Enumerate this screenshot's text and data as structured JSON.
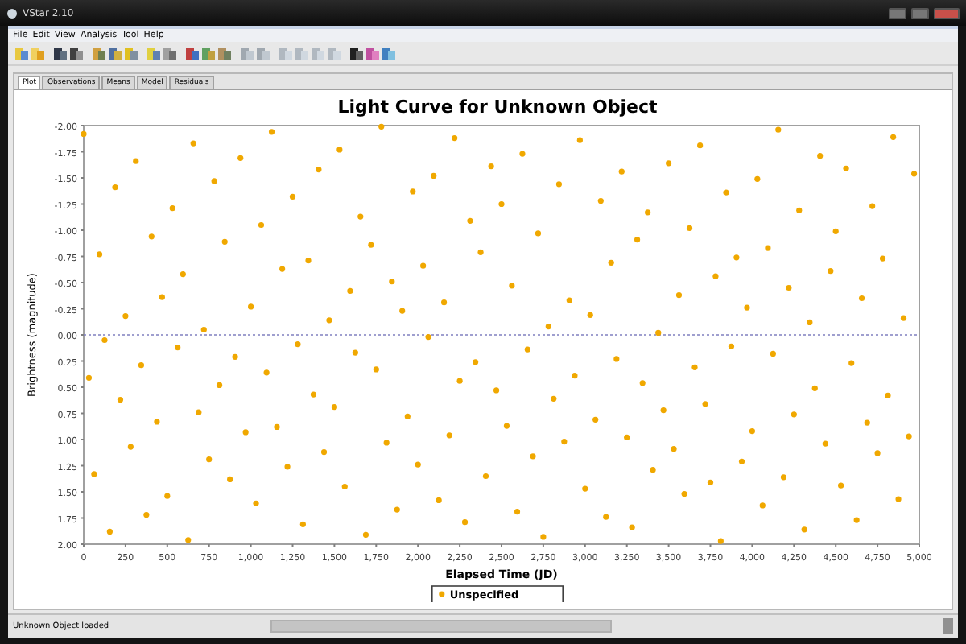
{
  "window": {
    "title": "VStar 2.10"
  },
  "menu": [
    "File",
    "Edit",
    "View",
    "Analysis",
    "Tool",
    "Help"
  ],
  "tabs": [
    {
      "label": "Plot",
      "selected": true
    },
    {
      "label": "Observations",
      "selected": false
    },
    {
      "label": "Means",
      "selected": false
    },
    {
      "label": "Model",
      "selected": false
    },
    {
      "label": "Residuals",
      "selected": false
    }
  ],
  "plot": {
    "chart_data": {
      "type": "scatter",
      "title": "Light Curve for Unknown Object",
      "xlabel": "Elapsed Time (JD)",
      "ylabel": "Brightness (magnitude)",
      "xlim": [
        0,
        5000
      ],
      "ylim": [
        2,
        -2
      ],
      "ref_lines": [
        {
          "axis": "y",
          "value": 0
        }
      ],
      "xticks": [
        {
          "value": 0,
          "label": "0"
        },
        {
          "value": 250,
          "label": "250"
        },
        {
          "value": 500,
          "label": "500"
        },
        {
          "value": 750,
          "label": "750"
        },
        {
          "value": 1000,
          "label": "1,000"
        },
        {
          "value": 1250,
          "label": "1,250"
        },
        {
          "value": 1500,
          "label": "1,500"
        },
        {
          "value": 1750,
          "label": "1,750"
        },
        {
          "value": 2000,
          "label": "2,000"
        },
        {
          "value": 2250,
          "label": "2,250"
        },
        {
          "value": 2500,
          "label": "2,500"
        },
        {
          "value": 2750,
          "label": "2,750"
        },
        {
          "value": 3000,
          "label": "3,000"
        },
        {
          "value": 3250,
          "label": "3,250"
        },
        {
          "value": 3500,
          "label": "3,500"
        },
        {
          "value": 3750,
          "label": "3,750"
        },
        {
          "value": 4000,
          "label": "4,000"
        },
        {
          "value": 4250,
          "label": "4,250"
        },
        {
          "value": 4500,
          "label": "4,500"
        },
        {
          "value": 4750,
          "label": "4,750"
        },
        {
          "value": 5000,
          "label": "5,000"
        }
      ],
      "yticks": [
        {
          "value": -2,
          "label": "-2.00"
        },
        {
          "value": -1.75,
          "label": "-1.75"
        },
        {
          "value": -1.5,
          "label": "-1.50"
        },
        {
          "value": -1.25,
          "label": "-1.25"
        },
        {
          "value": -1,
          "label": "-1.00"
        },
        {
          "value": -0.75,
          "label": "-0.75"
        },
        {
          "value": -0.5,
          "label": "-0.50"
        },
        {
          "value": -0.25,
          "label": "-0.25"
        },
        {
          "value": 0,
          "label": "0.00"
        },
        {
          "value": 0.25,
          "label": "0.25"
        },
        {
          "value": 0.5,
          "label": "0.50"
        },
        {
          "value": 0.75,
          "label": "0.75"
        },
        {
          "value": 1,
          "label": "1.00"
        },
        {
          "value": 1.25,
          "label": "1.25"
        },
        {
          "value": 1.5,
          "label": "1.50"
        },
        {
          "value": 1.75,
          "label": "1.75"
        },
        {
          "value": 2,
          "label": "2.00"
        }
      ],
      "x": [
        0,
        31,
        62,
        94,
        125,
        156,
        188,
        219,
        250,
        281,
        312,
        344,
        375,
        406,
        438,
        469,
        500,
        531,
        562,
        594,
        625,
        656,
        688,
        719,
        750,
        781,
        812,
        844,
        875,
        906,
        938,
        969,
        1000,
        1031,
        1062,
        1094,
        1125,
        1156,
        1188,
        1219,
        1250,
        1281,
        1312,
        1344,
        1375,
        1406,
        1438,
        1469,
        1500,
        1531,
        1562,
        1594,
        1625,
        1656,
        1688,
        1719,
        1750,
        1781,
        1812,
        1844,
        1875,
        1906,
        1938,
        1969,
        2000,
        2031,
        2062,
        2094,
        2125,
        2156,
        2188,
        2219,
        2250,
        2281,
        2312,
        2344,
        2375,
        2406,
        2438,
        2469,
        2500,
        2531,
        2562,
        2594,
        2625,
        2656,
        2688,
        2719,
        2750,
        2781,
        2812,
        2844,
        2875,
        2906,
        2938,
        2969,
        3000,
        3031,
        3062,
        3094,
        3125,
        3156,
        3188,
        3219,
        3250,
        3281,
        3312,
        3344,
        3375,
        3406,
        3438,
        3469,
        3500,
        3531,
        3562,
        3594,
        3625,
        3656,
        3688,
        3719,
        3750,
        3781,
        3812,
        3844,
        3875,
        3906,
        3938,
        3969,
        4000,
        4031,
        4062,
        4094,
        4125,
        4156,
        4188,
        4219,
        4250,
        4281,
        4312,
        4344,
        4375,
        4406,
        4438,
        4469,
        4500,
        4531,
        4562,
        4594,
        4625,
        4656,
        4688,
        4719,
        4750,
        4781,
        4812,
        4844,
        4875,
        4906,
        4938,
        4969
      ],
      "series": [
        {
          "name": "Unspecified",
          "color": "#f0a800",
          "values": [
            -1.92,
            0.41,
            1.33,
            -0.77,
            0.05,
            1.88,
            -1.41,
            0.62,
            -0.18,
            1.07,
            -1.66,
            0.29,
            1.72,
            -0.94,
            0.83,
            -0.36,
            1.54,
            -1.21,
            0.12,
            -0.58,
            1.96,
            -1.83,
            0.74,
            -0.05,
            1.19,
            -1.47,
            0.48,
            -0.89,
            1.38,
            0.21,
            -1.69,
            0.93,
            -0.27,
            1.61,
            -1.05,
            0.36,
            -1.94,
            0.88,
            -0.63,
            1.26,
            -1.32,
            0.09,
            1.81,
            -0.71,
            0.57,
            -1.58,
            1.12,
            -0.14,
            0.69,
            -1.77,
            1.45,
            -0.42,
            0.17,
            -1.13,
            1.91,
            -0.86,
            0.33,
            -1.99,
            1.03,
            -0.51,
            1.67,
            -0.23,
            0.78,
            -1.37,
            1.24,
            -0.66,
            0.02,
            -1.52,
            1.58,
            -0.31,
            0.96,
            -1.88,
            0.44,
            1.79,
            -1.09,
            0.26,
            -0.79,
            1.35,
            -1.61,
            0.53,
            -1.25,
            0.87,
            -0.47,
            1.69,
            -1.73,
            0.14,
            1.16,
            -0.97,
            1.93,
            -0.08,
            0.61,
            -1.44,
            1.02,
            -0.33,
            0.39,
            -1.86,
            1.47,
            -0.19,
            0.81,
            -1.28,
            1.74,
            -0.69,
            0.23,
            -1.56,
            0.98,
            1.84,
            -0.91,
            0.46,
            -1.17,
            1.29,
            -0.02,
            0.72,
            -1.64,
            1.09,
            -0.38,
            1.52,
            -1.02,
            0.31,
            -1.81,
            0.66,
            1.41,
            -0.56,
            1.97,
            -1.36,
            0.11,
            -0.74,
            1.21,
            -0.26,
            0.92,
            -1.49,
            1.63,
            -0.83,
            0.18,
            -1.96,
            1.36,
            -0.45,
            0.76,
            -1.19,
            1.86,
            -0.12,
            0.51,
            -1.71,
            1.04,
            -0.61,
            -0.99,
            1.44,
            -1.59,
            0.27,
            1.77,
            -0.35,
            0.84,
            -1.23,
            1.13,
            -0.73,
            0.58,
            -1.89,
            1.57,
            -0.16,
            0.97,
            -1.54
          ]
        }
      ]
    }
  },
  "status_bar": {
    "message": "Unknown Object loaded"
  }
}
